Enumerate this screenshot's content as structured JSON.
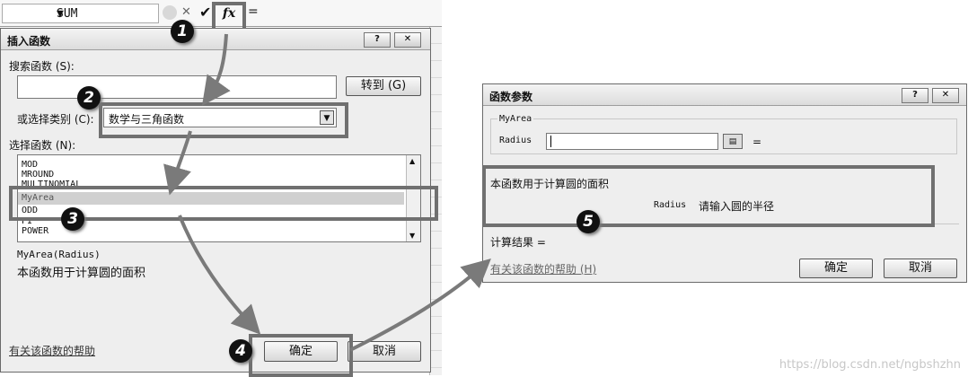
{
  "formula_bar": {
    "name_box": "SUM",
    "fx_label": "fx",
    "equals": "="
  },
  "insert_dialog": {
    "title": "插入函数",
    "help_btn": "?",
    "close_btn": "✕",
    "search_label": "搜索函数 (S):",
    "search_value": "",
    "go_button": "转到 (G)",
    "category_label": "或选择类别 (C):",
    "category_value": "数学与三角函数",
    "select_label": "选择函数 (N):",
    "functions": [
      "MOD",
      "MROUND",
      "MULTINOMIAL",
      "MyArea",
      "ODD",
      "PI",
      "POWER"
    ],
    "selected_function": "MyArea",
    "signature": "MyArea(Radius)",
    "description": "本函数用于计算圆的面积",
    "help_link": "有关该函数的帮助",
    "ok_button": "确定",
    "cancel_button": "取消"
  },
  "args_dialog": {
    "title": "函数参数",
    "help_btn": "?",
    "close_btn": "✕",
    "group_label": "MyArea",
    "arg_label": "Radius",
    "arg_value": "",
    "arg_equals": "=",
    "description": "本函数用于计算圆的面积",
    "arg_help_name": "Radius",
    "arg_help_text": "请输入圆的半径",
    "result_label": "计算结果 =",
    "help_link": "有关该函数的帮助 (H)",
    "ok_button": "确定",
    "cancel_button": "取消"
  },
  "badges": [
    "1",
    "2",
    "3",
    "4",
    "5"
  ],
  "watermark": "https://blog.csdn.net/ngbshzhn"
}
